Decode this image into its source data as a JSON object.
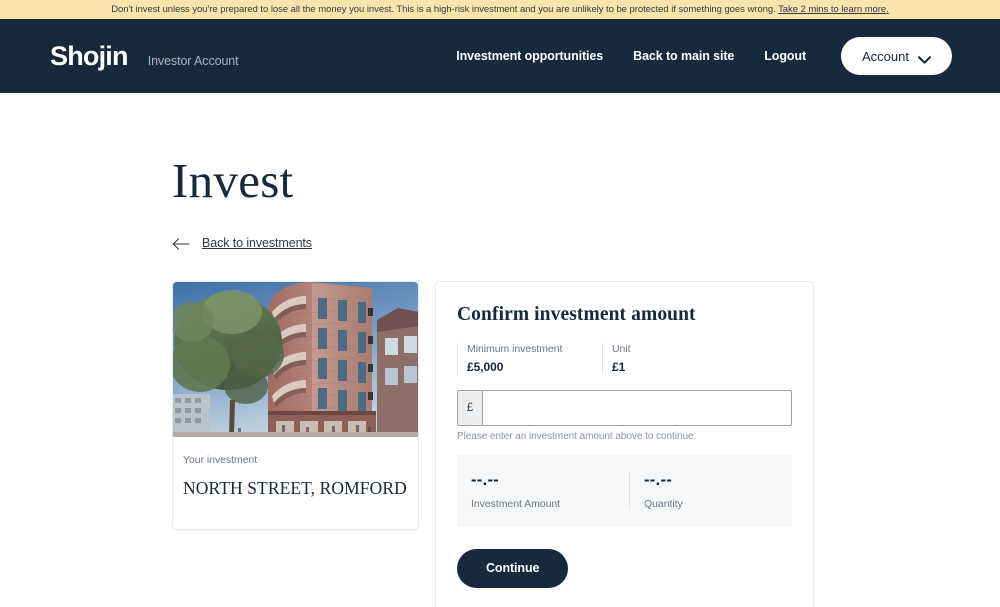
{
  "risk_banner": {
    "text": "Don't invest unless you're prepared to lose all the money you invest. This is a high-risk investment and you are unlikely to be protected if something goes wrong.",
    "link_label": "Take 2 mins to learn more.",
    "background_color": "#fae4ac",
    "text_color": "#2f3a46"
  },
  "header": {
    "brand": "Shojin",
    "account_type": "Investor Account",
    "background_color": "#16293d",
    "nav": [
      {
        "label": "Investment opportunities"
      },
      {
        "label": "Back to main site"
      },
      {
        "label": "Logout"
      }
    ],
    "account_button": {
      "label": "Account",
      "icon": "chevron-down-icon"
    }
  },
  "page": {
    "title": "Invest",
    "back_link": {
      "label": "Back to investments",
      "icon": "arrow-left-icon"
    }
  },
  "property_card": {
    "image_alt": "north-street-romford-building-render",
    "eyebrow": "Your investment",
    "name": "NORTH STREET, ROMFORD"
  },
  "invest_card": {
    "title": "Confirm investment amount",
    "facts": [
      {
        "label": "Minimum investment",
        "value": "£5,000"
      },
      {
        "label": "Unit",
        "value": "£1"
      }
    ],
    "amount_input": {
      "prefix": "£",
      "value": "",
      "placeholder": ""
    },
    "hint": "Please enter an investment amount above to continue.",
    "summary": [
      {
        "value": "--.--",
        "label": "Investment Amount"
      },
      {
        "value": "--.--",
        "label": "Quantity"
      }
    ],
    "continue_label": "Continue"
  }
}
